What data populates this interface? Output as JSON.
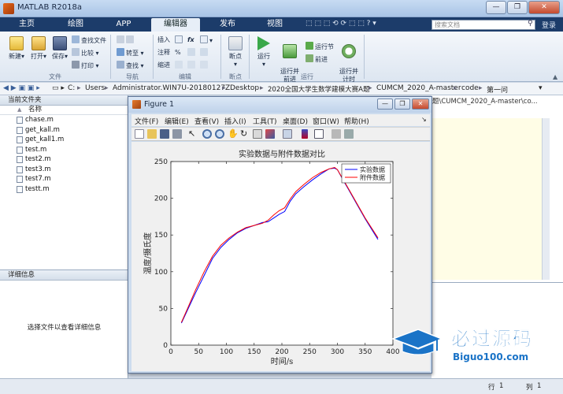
{
  "window": {
    "title": "MATLAB R2018a",
    "controls": [
      "—",
      "❐",
      "✕"
    ]
  },
  "ribbon": {
    "tabs": [
      "主页",
      "绘图",
      "APP",
      "编辑器",
      "发布",
      "视图"
    ],
    "active_tab": "编辑器",
    "search_placeholder": "搜索文档",
    "login": "登录",
    "file_group": {
      "label": "文件",
      "new": "新建",
      "open": "打开",
      "save": "保存",
      "find_files": "查找文件",
      "compare": "比较",
      "print": "打印"
    },
    "nav_group": {
      "label": "导航",
      "goto": "转至",
      "find": "查找"
    },
    "edit_group": {
      "label": "编辑",
      "insert": "插入",
      "comment": "注释",
      "indent": "缩进",
      "fx": "fx"
    },
    "breakpoint_group": {
      "label": "断点",
      "breakpoint": "断点"
    },
    "run_group": {
      "label": "运行",
      "run": "运行",
      "run_advance": "运行并\n前进",
      "run_section": "运行节",
      "advance": "前进",
      "run_time": "运行并\n计时"
    }
  },
  "address": {
    "segments": [
      "C:",
      "Users",
      "Administrator.WIN7U-20180127Z",
      "Desktop",
      "2020全国大学生数学建模大赛A题",
      "CUMCM_2020_A-master",
      "code",
      "第一问"
    ]
  },
  "file_browser": {
    "title": "当前文件夹",
    "column": "名称",
    "sort_indicator": "▲",
    "files": [
      "chase.m",
      "get_kall.m",
      "get_kall1.m",
      "test.m",
      "test2.m",
      "test3.m",
      "test7.m",
      "testt.m"
    ]
  },
  "details": {
    "title": "详细信息",
    "message": "选择文件以查看详细信息"
  },
  "background_editor": {
    "path": "题\\CUMCM_2020_A-master\\co..."
  },
  "status_bar": {
    "row_label": "行",
    "row_value": "1",
    "col_label": "列",
    "col_value": "1"
  },
  "figure": {
    "title": "Figure 1",
    "menu": [
      "文件(F)",
      "编辑(E)",
      "查看(V)",
      "插入(I)",
      "工具(T)",
      "桌面(D)",
      "窗口(W)",
      "帮助(H)"
    ],
    "toolbar_icons": [
      "new-icon",
      "open-icon",
      "save-icon",
      "print-icon",
      "pointer-icon",
      "zoom-in-icon",
      "zoom-out-icon",
      "pan-icon",
      "rotate-icon",
      "datatip-icon",
      "brush-icon",
      "link-icon",
      "colorbar-icon",
      "legend-icon",
      "hide-plot-icon",
      "show-plot-icon"
    ]
  },
  "chart_data": {
    "type": "line",
    "title": "实验数据与附件数据对比",
    "xlabel": "时间/s",
    "ylabel": "温度/摄氏度",
    "xlim": [
      0,
      400
    ],
    "ylim": [
      0,
      250
    ],
    "xticks": [
      0,
      50,
      100,
      150,
      200,
      250,
      300,
      350,
      400
    ],
    "yticks": [
      0,
      50,
      100,
      150,
      200,
      250
    ],
    "legend_position": "top-right",
    "series": [
      {
        "name": "实验数据",
        "color": "#0000ff",
        "x": [
          19,
          30,
          45,
          60,
          75,
          90,
          105,
          120,
          135,
          150,
          165,
          175,
          185,
          195,
          205,
          215,
          225,
          240,
          255,
          270,
          285,
          295,
          300,
          310,
          320,
          335,
          350,
          373
        ],
        "y": [
          30,
          48,
          72,
          95,
          118,
          133,
          144,
          153,
          159,
          163,
          167,
          168,
          173,
          178,
          182,
          196,
          206,
          216,
          225,
          233,
          240,
          241,
          239,
          225,
          212,
          192,
          172,
          144
        ]
      },
      {
        "name": "附件数据",
        "color": "#ff0000",
        "x": [
          19,
          30,
          45,
          60,
          75,
          90,
          105,
          120,
          135,
          150,
          165,
          175,
          185,
          195,
          205,
          215,
          225,
          240,
          255,
          270,
          285,
          295,
          300,
          310,
          320,
          335,
          350,
          373
        ],
        "y": [
          31,
          50,
          76,
          100,
          121,
          136,
          146,
          154,
          160,
          163,
          166,
          170,
          177,
          183,
          187,
          199,
          209,
          219,
          228,
          235,
          240,
          242,
          239,
          226,
          213,
          193,
          173,
          146
        ]
      }
    ]
  },
  "watermark": {
    "text": "必过源码",
    "sub": "Biguo100.com"
  }
}
